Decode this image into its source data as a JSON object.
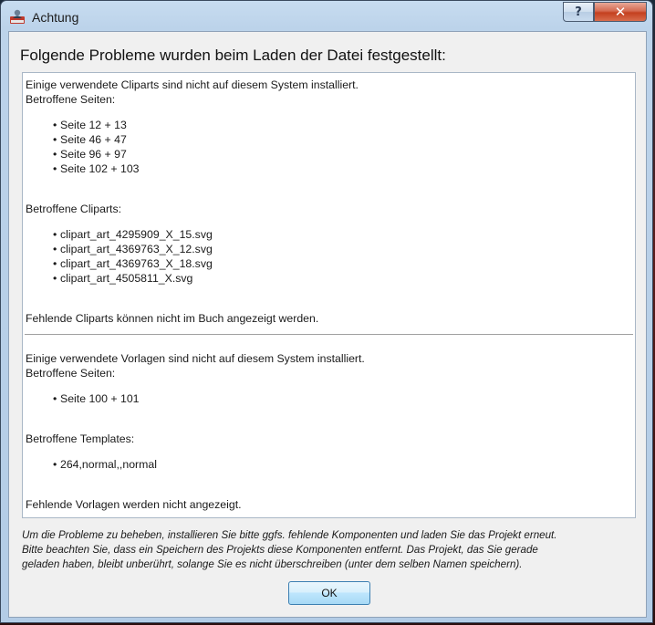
{
  "window": {
    "title": "Achtung"
  },
  "controls": {
    "help_label": "?",
    "close_label": "✕"
  },
  "dialog": {
    "heading": "Folgende Probleme wurden beim Laden der Datei festgestellt:",
    "cliparts_section": {
      "intro": "Einige verwendete Cliparts sind nicht auf diesem System installiert.",
      "pages_label": "Betroffene Seiten:",
      "pages": [
        "Seite 12 + 13",
        "Seite 46 + 47",
        "Seite 96 + 97",
        "Seite 102 + 103"
      ],
      "items_label": "Betroffene Cliparts:",
      "items": [
        "clipart_art_4295909_X_15.svg",
        "clipart_art_4369763_X_12.svg",
        "clipart_art_4369763_X_18.svg",
        "clipart_art_4505811_X.svg"
      ],
      "footer": "Fehlende Cliparts können nicht im Buch angezeigt werden."
    },
    "templates_section": {
      "intro": "Einige verwendete Vorlagen sind nicht auf diesem System installiert.",
      "pages_label": "Betroffene Seiten:",
      "pages": [
        "Seite 100 + 101"
      ],
      "items_label": "Betroffene Templates:",
      "items": [
        "264,normal,,normal"
      ],
      "footer": "Fehlende Vorlagen werden nicht angezeigt."
    },
    "note_lines": [
      "Um die Probleme zu beheben, installieren Sie bitte ggfs. fehlende Komponenten und laden Sie das Projekt erneut.",
      "Bitte beachten Sie, dass ein Speichern des Projekts diese Komponenten entfernt. Das Projekt, das Sie gerade",
      "geladen haben, bleibt unberührt, solange Sie es nicht überschreiben (unter dem selben Namen speichern)."
    ],
    "ok_label": "OK"
  }
}
